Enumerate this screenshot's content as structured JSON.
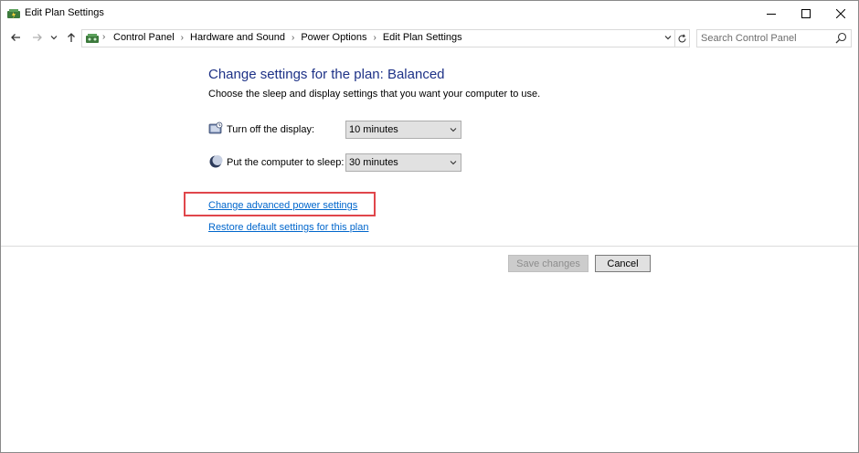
{
  "window": {
    "title": "Edit Plan Settings",
    "app_icon": "power-options-icon"
  },
  "titlebar_buttons": {
    "minimize": "minimize-icon",
    "maximize": "maximize-icon",
    "close": "close-icon"
  },
  "address_bar": {
    "breadcrumbs": [
      "Control Panel",
      "Hardware and Sound",
      "Power Options",
      "Edit Plan Settings"
    ],
    "search_placeholder": "Search Control Panel"
  },
  "main": {
    "heading": "Change settings for the plan: Balanced",
    "description": "Choose the sleep and display settings that you want your computer to use.",
    "settings": [
      {
        "label": "Turn off the display:",
        "value": "10 minutes",
        "icon": "display-icon"
      },
      {
        "label": "Put the computer to sleep:",
        "value": "30 minutes",
        "icon": "moon-icon"
      }
    ],
    "links": {
      "advanced": "Change advanced power settings",
      "restore": "Restore default settings for this plan"
    }
  },
  "footer": {
    "save_label": "Save changes",
    "cancel_label": "Cancel"
  },
  "colors": {
    "heading": "#1e3287",
    "link": "#0066cc",
    "highlight": "#e0464b"
  }
}
